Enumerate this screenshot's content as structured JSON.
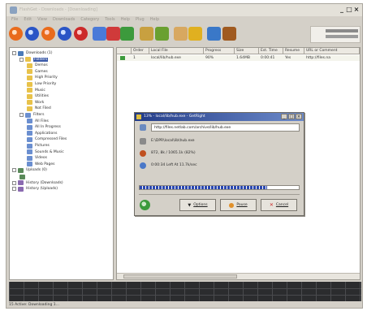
{
  "window": {
    "title": "FlashGet - Downloads - [Downloading]"
  },
  "menu": [
    "File",
    "Edit",
    "View",
    "Downloads",
    "Category",
    "Tools",
    "Help",
    "Plug",
    "Help"
  ],
  "toolbar": {
    "buttons": [
      "new-download",
      "start",
      "pause",
      "stop",
      "delete",
      "move-up",
      "move-down",
      "find",
      "sort",
      "options",
      "site-explorer",
      "default-icon",
      "add-server"
    ],
    "colors": {
      "orange": "#e96b1c",
      "blue": "#2a55c6",
      "red": "#cc2a2a",
      "green": "#3c9a3c",
      "yellow": "#e0b020"
    }
  },
  "tree": {
    "items": [
      {
        "label": "Downloads (1)",
        "level": 0,
        "expander": true,
        "icon": "globe-icon"
      },
      {
        "label": "Folders",
        "level": 1,
        "expander": true,
        "icon": "folder-icon",
        "selected": true
      },
      {
        "label": "Demos",
        "level": 2,
        "icon": "folder-icon"
      },
      {
        "label": "Games",
        "level": 2,
        "icon": "folder-icon"
      },
      {
        "label": "High Priority",
        "level": 2,
        "icon": "folder-icon"
      },
      {
        "label": "Low Priority",
        "level": 2,
        "icon": "folder-icon"
      },
      {
        "label": "Music",
        "level": 2,
        "icon": "folder-icon"
      },
      {
        "label": "Utilities",
        "level": 2,
        "icon": "folder-icon"
      },
      {
        "label": "Work",
        "level": 2,
        "icon": "folder-icon"
      },
      {
        "label": "Not Filed",
        "level": 2,
        "icon": "folder-icon"
      },
      {
        "label": "Filters",
        "level": 1,
        "expander": true,
        "icon": "filter-icon"
      },
      {
        "label": "All Files",
        "level": 2,
        "icon": "filter-icon"
      },
      {
        "label": "All In Progress",
        "level": 2,
        "icon": "filter-icon"
      },
      {
        "label": "Applications",
        "level": 2,
        "icon": "filter-icon"
      },
      {
        "label": "Compressed Files",
        "level": 2,
        "icon": "filter-icon"
      },
      {
        "label": "Pictures",
        "level": 2,
        "icon": "filter-icon"
      },
      {
        "label": "Sounds & Music",
        "level": 2,
        "icon": "filter-icon"
      },
      {
        "label": "Videos",
        "level": 2,
        "icon": "filter-icon"
      },
      {
        "label": "Web Pages",
        "level": 2,
        "icon": "filter-icon"
      },
      {
        "label": "Uploads (0)",
        "level": 0,
        "expander": true,
        "icon": "upload-icon"
      },
      {
        "label": "",
        "level": 1,
        "icon": "upload-icon"
      },
      {
        "label": "History (Downloads)",
        "level": 0,
        "expander": true,
        "icon": "history-icon"
      },
      {
        "label": "History (Uploads)",
        "level": 0,
        "expander": true,
        "icon": "history-icon"
      }
    ]
  },
  "list": {
    "columns": [
      "",
      "Order",
      "Local File",
      "Progress",
      "Size",
      "Est. Time",
      "Resume",
      "URL or Comment"
    ],
    "rows": [
      {
        "status": "",
        "order": "1",
        "file": "local/lib/hub.exe",
        "progress": "90%",
        "size": "1.64MB",
        "est": "0:00:41",
        "resume": "Yes",
        "url": "http://files.na"
      }
    ]
  },
  "graph": {
    "background": "#2b2c2e"
  },
  "statusbar": {
    "text": "15 Active: Downloading 1..."
  },
  "dialog": {
    "title": "13% - local/lib/hub.exe - GetRight",
    "url": "http://files.netlab.com/archive/lib/hub.exe",
    "local": "E:\\DPR\\local\\lib\\hub.exe",
    "size": "872, 8k / 1065.1k (82%)",
    "time": "0:00:34 Left At 11.7k/sec",
    "progress": 0.8,
    "buttons": {
      "options": "Options",
      "pause": "Pause",
      "cancel": "Cancel"
    }
  }
}
